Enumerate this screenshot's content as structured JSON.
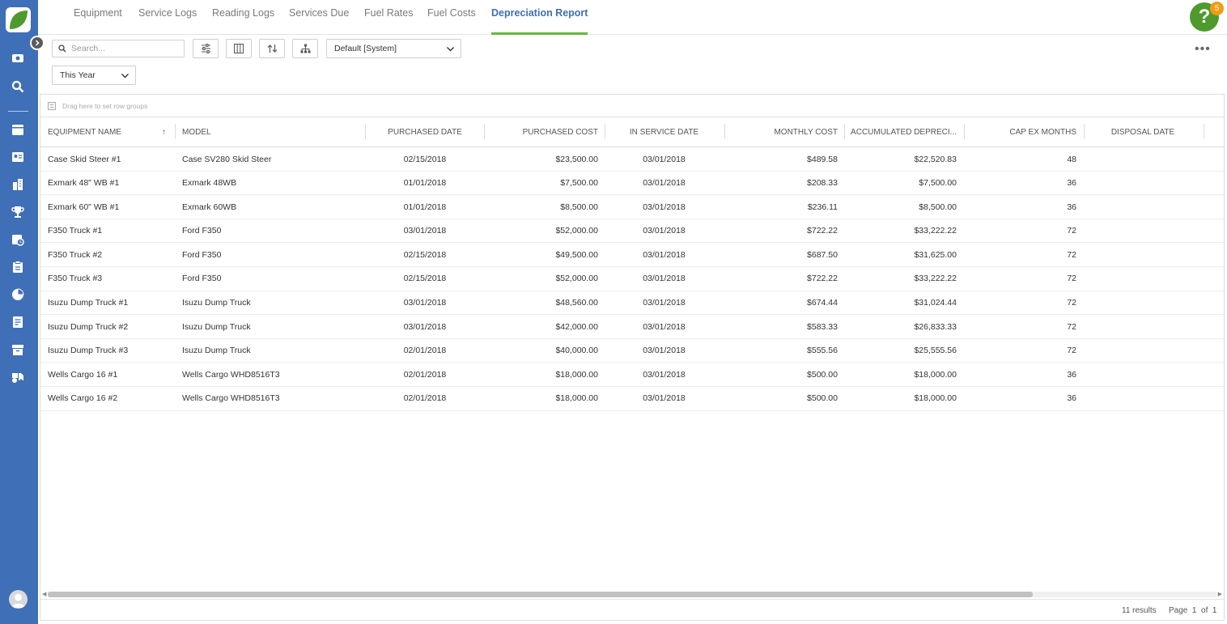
{
  "colors": {
    "sidebar": "#3f6fb6",
    "accent": "#3f6fb6",
    "tab_underline": "#6cb343",
    "help": "#4f9a2c",
    "badge": "#f39c12"
  },
  "sidebar": {
    "items": [
      {
        "icon": "dashboard-icon"
      },
      {
        "icon": "search-icon"
      },
      {
        "icon": "calendar-icon"
      },
      {
        "icon": "contacts-card-icon"
      },
      {
        "icon": "building-icon"
      },
      {
        "icon": "trophy-icon"
      },
      {
        "icon": "schedule-icon"
      },
      {
        "icon": "clipboard-icon"
      },
      {
        "icon": "pie-chart-icon"
      },
      {
        "icon": "report-icon"
      },
      {
        "icon": "archive-icon"
      },
      {
        "icon": "equipment-icon"
      }
    ]
  },
  "tabs": [
    {
      "label": "Equipment"
    },
    {
      "label": "Service Logs"
    },
    {
      "label": "Reading Logs"
    },
    {
      "label": "Services Due"
    },
    {
      "label": "Fuel Rates"
    },
    {
      "label": "Fuel Costs"
    },
    {
      "label": "Depreciation Report",
      "active": true
    }
  ],
  "help": {
    "label": "?",
    "badge": "5"
  },
  "toolbar": {
    "search_placeholder": "Search...",
    "view_select": "Default [System]",
    "period_select": "This Year",
    "more": "•••"
  },
  "grid": {
    "group_hint": "Drag here to set row groups",
    "columns": [
      "Equipment Name",
      "Model",
      "Purchased Date",
      "Purchased Cost",
      "In Service Date",
      "Monthly Cost",
      "Accumulated Depreci...",
      "Cap Ex Months",
      "Disposal Date"
    ],
    "sort_indicator": "↑",
    "rows": [
      [
        "Case Skid Steer #1",
        "Case SV280 Skid Steer",
        "02/15/2018",
        "$23,500.00",
        "03/01/2018",
        "$489.58",
        "$22,520.83",
        "48",
        ""
      ],
      [
        "Exmark 48\" WB #1",
        "Exmark 48WB",
        "01/01/2018",
        "$7,500.00",
        "03/01/2018",
        "$208.33",
        "$7,500.00",
        "36",
        ""
      ],
      [
        "Exmark 60\" WB #1",
        "Exmark 60WB",
        "01/01/2018",
        "$8,500.00",
        "03/01/2018",
        "$236.11",
        "$8,500.00",
        "36",
        ""
      ],
      [
        "F350 Truck #1",
        "Ford F350",
        "03/01/2018",
        "$52,000.00",
        "03/01/2018",
        "$722.22",
        "$33,222.22",
        "72",
        ""
      ],
      [
        "F350 Truck #2",
        "Ford F350",
        "02/15/2018",
        "$49,500.00",
        "03/01/2018",
        "$687.50",
        "$31,625.00",
        "72",
        ""
      ],
      [
        "F350 Truck #3",
        "Ford F350",
        "02/15/2018",
        "$52,000.00",
        "03/01/2018",
        "$722.22",
        "$33,222.22",
        "72",
        ""
      ],
      [
        "Isuzu Dump Truck #1",
        "Isuzu Dump Truck",
        "03/01/2018",
        "$48,560.00",
        "03/01/2018",
        "$674.44",
        "$31,024.44",
        "72",
        ""
      ],
      [
        "Isuzu Dump Truck #2",
        "Isuzu Dump Truck",
        "03/01/2018",
        "$42,000.00",
        "03/01/2018",
        "$583.33",
        "$26,833.33",
        "72",
        ""
      ],
      [
        "Isuzu Dump Truck #3",
        "Isuzu Dump Truck",
        "02/01/2018",
        "$40,000.00",
        "03/01/2018",
        "$555.56",
        "$25,555.56",
        "72",
        ""
      ],
      [
        "Wells Cargo 16 #1",
        "Wells Cargo WHD8516T3",
        "02/01/2018",
        "$18,000.00",
        "03/01/2018",
        "$500.00",
        "$18,000.00",
        "36",
        ""
      ],
      [
        "Wells Cargo 16 #2",
        "Wells Cargo WHD8516T3",
        "02/01/2018",
        "$18,000.00",
        "03/01/2018",
        "$500.00",
        "$18,000.00",
        "36",
        ""
      ]
    ],
    "results": "11 results",
    "page": "Page  1  of  1"
  }
}
